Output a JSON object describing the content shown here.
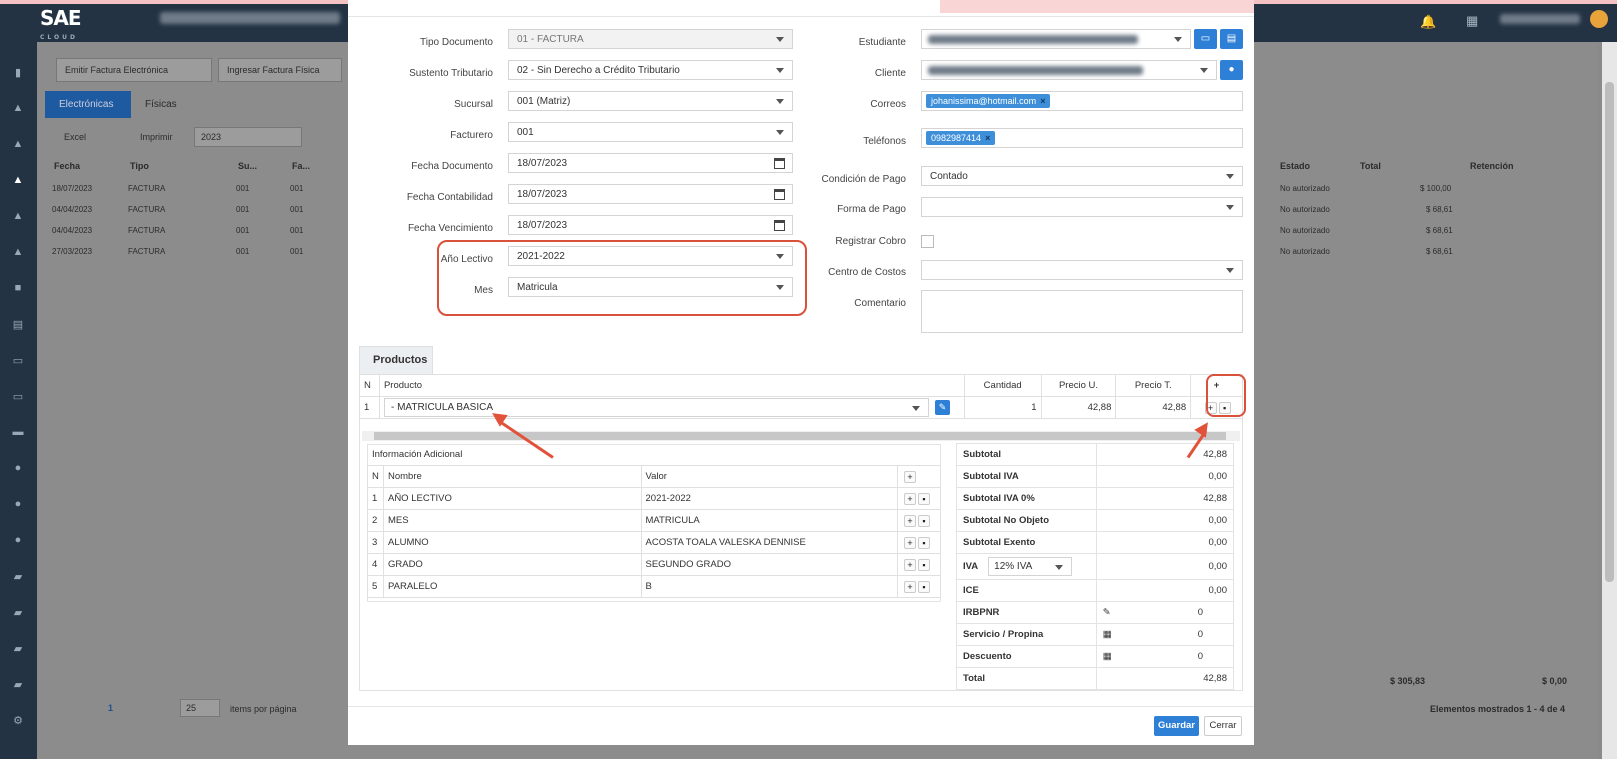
{
  "app": {
    "logo": "SAE",
    "logo_sub": "CLOUD"
  },
  "background": {
    "toolbar": {
      "emit": "Emitir Factura Electrónica",
      "physical": "Ingresar Factura Física"
    },
    "tabs": [
      "Electrónicas",
      "Físicas"
    ],
    "actions": {
      "excel": "Excel",
      "print": "Imprimir",
      "year": "2023"
    },
    "columns": [
      "Fecha",
      "Tipo",
      "Su...",
      "Fa...",
      "Estado",
      "Total",
      "Retención"
    ],
    "rows": [
      {
        "fecha": "18/07/2023",
        "tipo": "FACTURA",
        "su": "001",
        "fa": "001",
        "estado": "No autorizado",
        "total": "$ 100,00"
      },
      {
        "fecha": "04/04/2023",
        "tipo": "FACTURA",
        "su": "001",
        "fa": "001",
        "estado": "No autorizado",
        "total": "$ 68,61"
      },
      {
        "fecha": "04/04/2023",
        "tipo": "FACTURA",
        "su": "001",
        "fa": "001",
        "estado": "No autorizado",
        "total": "$ 68,61"
      },
      {
        "fecha": "27/03/2023",
        "tipo": "FACTURA",
        "su": "001",
        "fa": "001",
        "estado": "No autorizado",
        "total": "$ 68,61"
      }
    ],
    "footer_total": "$ 305,83",
    "footer_ret": "$ 0,00",
    "pager": {
      "page": "1",
      "size": "25",
      "per_page": "items por página",
      "shown": "Elementos mostrados 1 - 4 de 4"
    }
  },
  "form": {
    "left": [
      {
        "label": "Tipo Documento",
        "value": "01 - FACTURA"
      },
      {
        "label": "Sustento Tributario",
        "value": "02 - Sin Derecho a Crédito Tributario"
      },
      {
        "label": "Sucursal",
        "value": "001 (Matriz)"
      },
      {
        "label": "Facturero",
        "value": "001"
      },
      {
        "label": "Fecha Documento",
        "value": "18/07/2023"
      },
      {
        "label": "Fecha Contabilidad",
        "value": "18/07/2023"
      },
      {
        "label": "Fecha Vencimiento",
        "value": "18/07/2023"
      },
      {
        "label": "Año Lectivo",
        "value": "2021-2022"
      },
      {
        "label": "Mes",
        "value": "Matricula"
      }
    ],
    "right": {
      "estudiante": "Estudiante",
      "cliente": "Cliente",
      "correos": "Correos",
      "correo_chip": "johanissima@hotmail.com",
      "telefonos": "Teléfonos",
      "telefono_chip": "0982987414",
      "condicion": "Condición de Pago",
      "condicion_val": "Contado",
      "forma": "Forma de Pago",
      "registrar": "Registrar Cobro",
      "centro": "Centro de Costos",
      "comentario": "Comentario"
    }
  },
  "products": {
    "tab": "Productos",
    "headers": {
      "n": "N",
      "producto": "Producto",
      "cantidad": "Cantidad",
      "precio_u": "Precio U.",
      "precio_t": "Precio T.",
      "add": "+"
    },
    "row": {
      "n": "1",
      "producto": "- MATRICULA BASICA",
      "cantidad": "1",
      "precio_u": "42,88",
      "precio_t": "42,88"
    }
  },
  "info": {
    "title": "Información Adicional",
    "headers": {
      "n": "N",
      "nombre": "Nombre",
      "valor": "Valor"
    },
    "rows": [
      {
        "n": "1",
        "nombre": "AÑO LECTIVO",
        "valor": "2021-2022"
      },
      {
        "n": "2",
        "nombre": "MES",
        "valor": "MATRICULA"
      },
      {
        "n": "3",
        "nombre": "ALUMNO",
        "valor": "ACOSTA TOALA VALESKA DENNISE"
      },
      {
        "n": "4",
        "nombre": "GRADO",
        "valor": "SEGUNDO GRADO"
      },
      {
        "n": "5",
        "nombre": "PARALELO",
        "valor": "B"
      }
    ]
  },
  "totals": {
    "subtotal": {
      "k": "Subtotal",
      "v": "42,88"
    },
    "iva_sub": {
      "k": "Subtotal IVA",
      "v": "0,00"
    },
    "iva0": {
      "k": "Subtotal IVA 0%",
      "v": "42,88"
    },
    "noobj": {
      "k": "Subtotal No Objeto",
      "v": "0,00"
    },
    "exento": {
      "k": "Subtotal Exento",
      "v": "0,00"
    },
    "iva": {
      "k": "IVA",
      "sel": "12% IVA",
      "v": "0,00"
    },
    "ice": {
      "k": "ICE",
      "v": "0,00"
    },
    "irbpnr": {
      "k": "IRBPNR",
      "v": "0"
    },
    "servicio": {
      "k": "Servicio / Propina",
      "v": "0"
    },
    "descuento": {
      "k": "Descuento",
      "v": "0"
    },
    "total": {
      "k": "Total",
      "v": "42,88"
    }
  },
  "buttons": {
    "save": "Guardar",
    "close": "Cerrar"
  },
  "colors": {
    "accent": "#2e7fd6",
    "highlight": "#d9513a",
    "sidebar": "#233343"
  }
}
